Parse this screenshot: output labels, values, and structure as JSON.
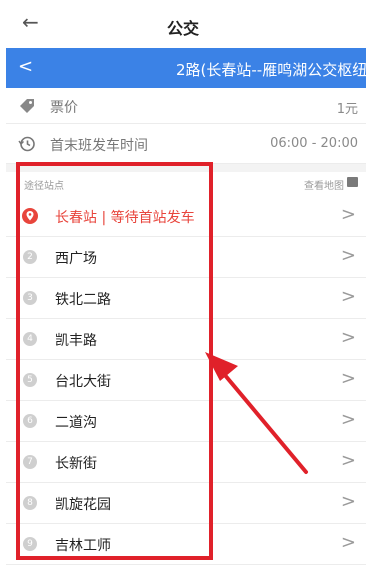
{
  "topbar": {
    "back_icon": "arrow-left-icon",
    "title": "公交"
  },
  "route_bar": {
    "back_icon": "chevron-left-icon",
    "title": "2路(长春站--雁鸣湖公交枢纽"
  },
  "fare": {
    "icon": "tag-icon",
    "label": "票价",
    "value": "1元"
  },
  "schedule": {
    "icon": "history-clock-icon",
    "label": "首末班发车时间",
    "value": "06:00 - 20:00"
  },
  "stops_section": {
    "label": "途径站点",
    "map_link": "查看地图",
    "map_icon": "map-icon"
  },
  "stops": [
    {
      "num": "",
      "name": "长春站 | 等待首站发车",
      "current": true
    },
    {
      "num": "2",
      "name": "西广场"
    },
    {
      "num": "3",
      "name": "铁北二路"
    },
    {
      "num": "4",
      "name": "凯丰路"
    },
    {
      "num": "5",
      "name": "台北大街"
    },
    {
      "num": "6",
      "name": "二道沟"
    },
    {
      "num": "7",
      "name": "长新街"
    },
    {
      "num": "8",
      "name": "凯旋花园"
    },
    {
      "num": "9",
      "name": "吉林工师"
    }
  ],
  "colors": {
    "accent": "#3b82e6",
    "highlight": "#e8453c",
    "annotation": "#e0212a"
  }
}
